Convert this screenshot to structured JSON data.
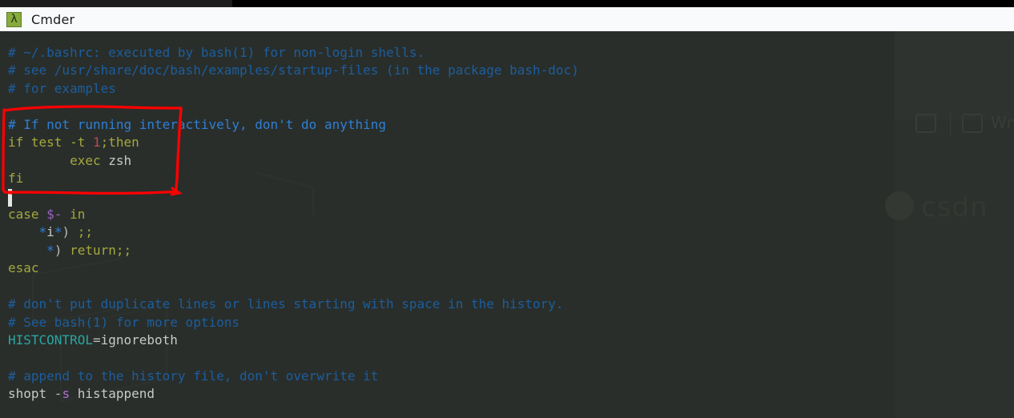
{
  "window": {
    "title": "Cmder",
    "icon": "lambda-icon",
    "icon_glyph": "λ",
    "icon_bg": "#87ac3e"
  },
  "theme": {
    "background": "#292e2b",
    "titlebar_background": "#f8fafc",
    "comment_dim": "#1d5d9c",
    "comment_bright": "#2f7fd4",
    "keyword": "#a5a83c",
    "number": "#b84a5c",
    "plain": "#c8c8c8",
    "variable": "#9a62c4",
    "env_var": "#2aa6a0",
    "annotation": "#ff0000"
  },
  "watermark": {
    "brand": "csdn",
    "ghost_label": "Wm"
  },
  "annotation": {
    "name": "red-highlight-box",
    "color": "#ff0000",
    "covers_lines": [
      3,
      4,
      5,
      6,
      7
    ]
  },
  "terminal": {
    "cursor": {
      "visible": true,
      "line": 8,
      "column": 0
    },
    "lines": [
      {
        "id": 0,
        "tokens": [
          {
            "t": "# ~/.bashrc: executed by bash(1) for non-login shells.",
            "c": "c-comment-dim"
          }
        ]
      },
      {
        "id": 1,
        "tokens": [
          {
            "t": "# see /usr/share/doc/bash/examples/startup-files (in the package bash-doc)",
            "c": "c-comment-dim"
          }
        ]
      },
      {
        "id": 2,
        "tokens": [
          {
            "t": "# for examples",
            "c": "c-comment-dim"
          }
        ]
      },
      {
        "id": 3,
        "tokens": [
          {
            "t": "",
            "c": "c-plain"
          }
        ]
      },
      {
        "id": 4,
        "tokens": [
          {
            "t": "# If not running interactively, don't do anything",
            "c": "c-comment-brite"
          }
        ]
      },
      {
        "id": 5,
        "tokens": [
          {
            "t": "if test -t ",
            "c": "c-keyword"
          },
          {
            "t": "1",
            "c": "c-number"
          },
          {
            "t": ";then",
            "c": "c-keyword"
          }
        ]
      },
      {
        "id": 6,
        "tokens": [
          {
            "t": "        exec ",
            "c": "c-keyword"
          },
          {
            "t": "zsh",
            "c": "c-plain"
          }
        ]
      },
      {
        "id": 7,
        "tokens": [
          {
            "t": "fi",
            "c": "c-keyword"
          }
        ]
      },
      {
        "id": 8,
        "tokens": [
          {
            "t": "",
            "c": "c-plain"
          }
        ]
      },
      {
        "id": 9,
        "tokens": [
          {
            "t": "case ",
            "c": "c-keyword"
          },
          {
            "t": "$-",
            "c": "c-var"
          },
          {
            "t": " in",
            "c": "c-keyword"
          }
        ]
      },
      {
        "id": 10,
        "tokens": [
          {
            "t": "    ",
            "c": "c-plain"
          },
          {
            "t": "*",
            "c": "c-star"
          },
          {
            "t": "i",
            "c": "c-plain"
          },
          {
            "t": "*",
            "c": "c-star"
          },
          {
            "t": ")",
            "c": "c-punct"
          },
          {
            "t": " ;;",
            "c": "c-keyword"
          }
        ]
      },
      {
        "id": 11,
        "tokens": [
          {
            "t": "     ",
            "c": "c-plain"
          },
          {
            "t": "*",
            "c": "c-star"
          },
          {
            "t": ")",
            "c": "c-punct"
          },
          {
            "t": " return;;",
            "c": "c-keyword"
          }
        ]
      },
      {
        "id": 12,
        "tokens": [
          {
            "t": "esac",
            "c": "c-keyword"
          }
        ]
      },
      {
        "id": 13,
        "tokens": [
          {
            "t": "",
            "c": "c-plain"
          }
        ]
      },
      {
        "id": 14,
        "tokens": [
          {
            "t": "# don't put duplicate lines or lines starting with space in the history.",
            "c": "c-comment-dim"
          }
        ]
      },
      {
        "id": 15,
        "tokens": [
          {
            "t": "# See bash(1) for more options",
            "c": "c-comment-dim"
          }
        ]
      },
      {
        "id": 16,
        "tokens": [
          {
            "t": "HISTCONTROL",
            "c": "c-env"
          },
          {
            "t": "=",
            "c": "c-punct"
          },
          {
            "t": "ignoreboth",
            "c": "c-plain"
          }
        ]
      },
      {
        "id": 17,
        "tokens": [
          {
            "t": "",
            "c": "c-plain"
          }
        ]
      },
      {
        "id": 18,
        "tokens": [
          {
            "t": "# append to the history file, don't overwrite it",
            "c": "c-comment-dim"
          }
        ]
      },
      {
        "id": 19,
        "tokens": [
          {
            "t": "shopt ",
            "c": "c-plain"
          },
          {
            "t": "-",
            "c": "c-punct"
          },
          {
            "t": "s",
            "c": "c-flag"
          },
          {
            "t": " histappend",
            "c": "c-plain"
          }
        ]
      }
    ]
  }
}
